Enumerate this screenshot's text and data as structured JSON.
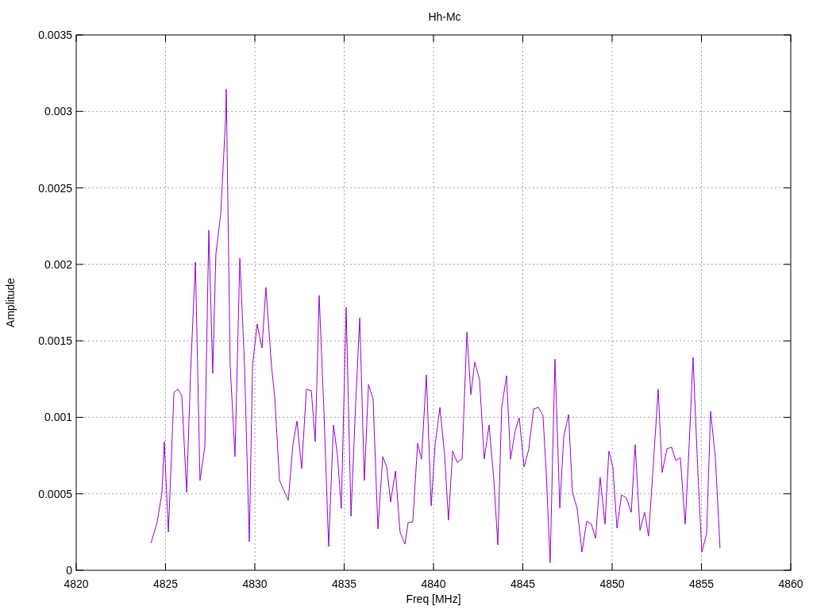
{
  "chart_data": {
    "type": "line",
    "title": "Hh-Mc",
    "xlabel": "Freq [MHz]",
    "ylabel": "Amplitude",
    "x": [
      4824.18,
      4824.53,
      4824.8,
      4824.93,
      4825.16,
      4825.47,
      4825.69,
      4825.91,
      4826.18,
      4826.4,
      4826.67,
      4826.93,
      4827.2,
      4827.42,
      4827.64,
      4827.82,
      4828.09,
      4828.36,
      4828.4,
      4828.62,
      4828.89,
      4829.16,
      4829.42,
      4829.69,
      4829.87,
      4830.13,
      4830.4,
      4830.62,
      4830.93,
      4831.11,
      4831.38,
      4831.87,
      4832.13,
      4832.36,
      4832.62,
      4832.89,
      4833.16,
      4833.38,
      4833.6,
      4833.87,
      4834.13,
      4834.4,
      4834.62,
      4834.84,
      4835.11,
      4835.38,
      4835.64,
      4835.87,
      4836.13,
      4836.36,
      4836.62,
      4836.89,
      4837.16,
      4837.38,
      4837.6,
      4837.87,
      4838.13,
      4838.4,
      4838.58,
      4838.84,
      4839.11,
      4839.33,
      4839.6,
      4839.87,
      4840.09,
      4840.36,
      4840.62,
      4840.84,
      4841.07,
      4841.33,
      4841.6,
      4841.87,
      4842.09,
      4842.31,
      4842.58,
      4842.84,
      4843.11,
      4843.38,
      4843.6,
      4843.82,
      4844.09,
      4844.31,
      4844.58,
      4844.8,
      4845.07,
      4845.33,
      4845.6,
      4845.87,
      4846.13,
      4846.31,
      4846.53,
      4846.8,
      4847.07,
      4847.29,
      4847.56,
      4847.78,
      4848.04,
      4848.31,
      4848.58,
      4848.84,
      4849.07,
      4849.33,
      4849.6,
      4849.82,
      4850.04,
      4850.27,
      4850.53,
      4850.8,
      4851.07,
      4851.29,
      4851.56,
      4851.82,
      4852.04,
      4852.31,
      4852.58,
      4852.8,
      4853.07,
      4853.33,
      4853.56,
      4853.82,
      4854.09,
      4854.27,
      4854.53,
      4854.8,
      4855.02,
      4855.29,
      4855.51,
      4855.78,
      4856.04
    ],
    "series": [
      {
        "color": "#9400d3",
        "values": [
          0.000177,
          0.000312,
          0.000509,
          0.000841,
          0.000249,
          0.001163,
          0.001184,
          0.001142,
          0.000509,
          0.001288,
          0.002015,
          0.000587,
          0.00081,
          0.002223,
          0.001288,
          0.002067,
          0.002326,
          0.00295,
          0.003147,
          0.00134,
          0.000743,
          0.002041,
          0.00134,
          0.000187,
          0.00134,
          0.00161,
          0.001454,
          0.001849,
          0.00134,
          0.001132,
          0.000587,
          0.000457,
          0.000821,
          0.000976,
          0.000665,
          0.001184,
          0.001174,
          0.000841,
          0.001797,
          0.001028,
          0.000156,
          0.00095,
          0.000758,
          0.000405,
          0.001719,
          0.000353,
          0.00108,
          0.001651,
          0.000587,
          0.001215,
          0.001122,
          0.00027,
          0.000743,
          0.000675,
          0.000447,
          0.000649,
          0.000249,
          0.000171,
          0.000312,
          0.000317,
          0.000831,
          0.000727,
          0.001277,
          0.000421,
          0.000821,
          0.001065,
          0.000758,
          0.000327,
          0.000779,
          0.000706,
          0.000727,
          0.001558,
          0.001148,
          0.001361,
          0.001246,
          0.000727,
          0.00095,
          0.000587,
          0.000166,
          0.001065,
          0.001272,
          0.000727,
          0.000914,
          0.000997,
          0.000675,
          0.000789,
          0.001054,
          0.001065,
          0.001013,
          0.000639,
          5e-05,
          0.001381,
          0.000405,
          0.000872,
          0.001018,
          0.000509,
          0.000405,
          0.000119,
          0.000322,
          0.000301,
          0.000208,
          0.000608,
          0.000301,
          0.000779,
          0.000675,
          0.000275,
          0.000493,
          0.000473,
          0.000379,
          0.000821,
          0.00026,
          0.000379,
          0.000223,
          0.000701,
          0.001184,
          0.000639,
          0.000795,
          0.000805,
          0.000717,
          0.000737,
          0.000301,
          0.000717,
          0.001392,
          0.000639,
          0.000119,
          0.000239,
          0.001039,
          0.000737,
          0.000145
        ]
      }
    ],
    "grid": true,
    "xlim": [
      4820,
      4860
    ],
    "ylim": [
      0,
      0.0035
    ],
    "xticks": [
      4820,
      4825,
      4830,
      4835,
      4840,
      4845,
      4850,
      4855,
      4860
    ],
    "yticks": [
      0,
      0.0005,
      0.001,
      0.0015,
      0.002,
      0.0025,
      0.003,
      0.0035
    ]
  }
}
